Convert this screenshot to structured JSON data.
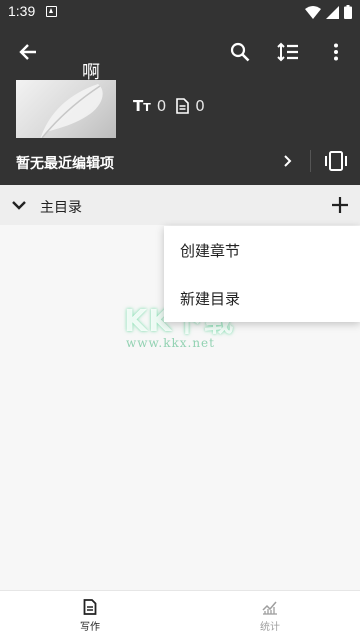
{
  "status_bar": {
    "time": "1:39"
  },
  "book": {
    "title": "啊",
    "word_count": "0",
    "chapter_count": "0"
  },
  "recent": {
    "label": "暂无最近编辑项"
  },
  "directory": {
    "title": "主目录"
  },
  "menu": {
    "items": [
      "创建章节",
      "新建目录"
    ]
  },
  "watermark": {
    "text": "KK下载",
    "url": "www.kkx.net"
  },
  "bottom_nav": {
    "items": [
      {
        "label": "写作",
        "icon": "document-icon",
        "active": true
      },
      {
        "label": "统计",
        "icon": "chart-icon",
        "active": false
      }
    ]
  },
  "colors": {
    "header_bg": "#333333",
    "page_bg": "#f7f7f7",
    "active": "#222222",
    "inactive": "#9e9e9e"
  }
}
